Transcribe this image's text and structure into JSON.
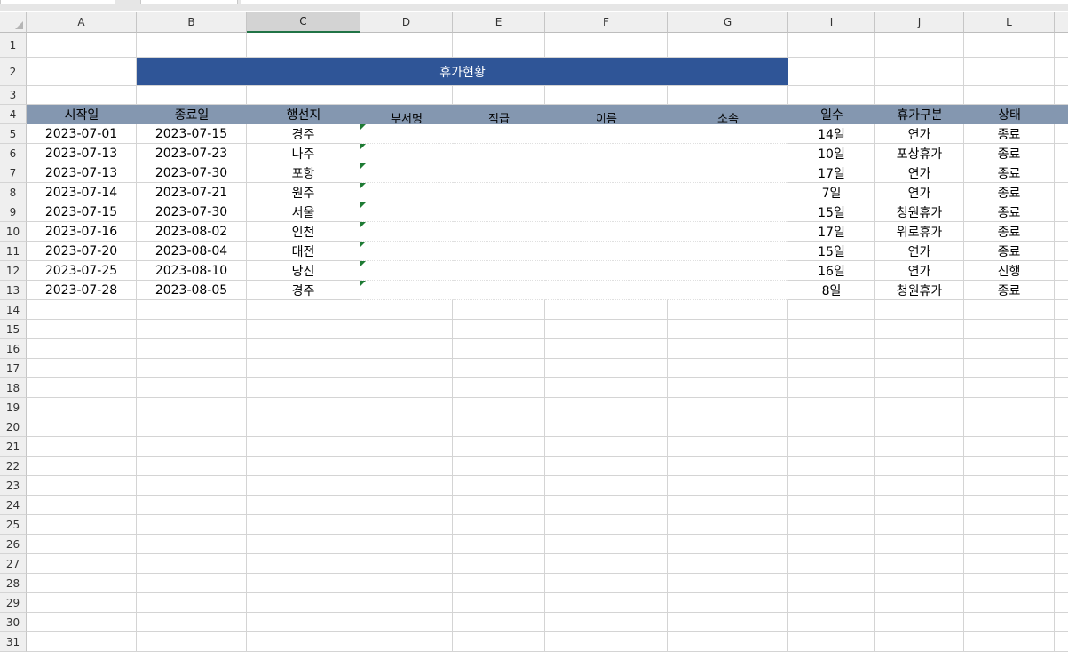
{
  "sheet": {
    "col_headers": [
      "A",
      "B",
      "C",
      "D",
      "E",
      "F",
      "G",
      "I",
      "J",
      "L"
    ],
    "selected_col": "C",
    "row_numbers": [
      "1",
      "2",
      "3",
      "4",
      "5",
      "6",
      "7",
      "8",
      "9",
      "10",
      "11",
      "12",
      "13",
      "14",
      "15",
      "16",
      "17",
      "18",
      "19",
      "20",
      "21",
      "22",
      "23",
      "24",
      "25",
      "26",
      "27",
      "28",
      "29",
      "30",
      "31"
    ],
    "title": "휴가현황",
    "headers": [
      "시작일",
      "종료일",
      "행선지",
      "부서명",
      "직급",
      "이름",
      "소속",
      "일수",
      "휴가구분",
      "상태"
    ],
    "rows": [
      [
        "2023-07-01",
        "2023-07-15",
        "경주",
        "14일",
        "연가",
        "종료"
      ],
      [
        "2023-07-13",
        "2023-07-23",
        "나주",
        "10일",
        "포상휴가",
        "종료"
      ],
      [
        "2023-07-13",
        "2023-07-30",
        "포항",
        "17일",
        "연가",
        "종료"
      ],
      [
        "2023-07-14",
        "2023-07-21",
        "원주",
        "7일",
        "연가",
        "종료"
      ],
      [
        "2023-07-15",
        "2023-07-30",
        "서울",
        "15일",
        "청원휴가",
        "종료"
      ],
      [
        "2023-07-16",
        "2023-08-02",
        "인천",
        "17일",
        "위로휴가",
        "종료"
      ],
      [
        "2023-07-20",
        "2023-08-04",
        "대전",
        "15일",
        "연가",
        "종료"
      ],
      [
        "2023-07-25",
        "2023-08-10",
        "당진",
        "16일",
        "연가",
        "진행"
      ],
      [
        "2023-07-28",
        "2023-08-05",
        "경주",
        "8일",
        "청원휴가",
        "종료"
      ]
    ]
  }
}
